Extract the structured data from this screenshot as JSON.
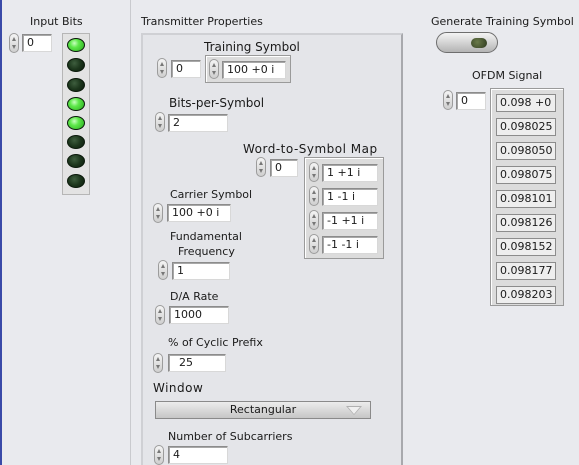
{
  "input_bits": {
    "title": "Input Bits",
    "index": "0",
    "leds": [
      true,
      false,
      false,
      true,
      true,
      false,
      false,
      false
    ]
  },
  "transmitter": {
    "title": "Transmitter Properties",
    "training_symbol": {
      "label": "Training Symbol",
      "index": "0",
      "value": "100 +0 i"
    },
    "bits_per_symbol": {
      "label": "Bits-per-Symbol",
      "value": "2"
    },
    "word_map": {
      "label": "Word-to-Symbol Map",
      "index": "0",
      "values": [
        "1 +1 i",
        "1 -1 i",
        "-1 +1 i",
        "-1 -1 i"
      ]
    },
    "carrier_symbol": {
      "label": "Carrier Symbol",
      "value": "100 +0 i"
    },
    "fundamental_frequency": {
      "label_line1": "Fundamental",
      "label_line2": "Frequency",
      "value": "1"
    },
    "da_rate": {
      "label": "D/A Rate",
      "value": "1000"
    },
    "cyclic_prefix": {
      "label": "% of Cyclic Prefix",
      "value": "25"
    },
    "window": {
      "label": "Window",
      "value": "Rectangular"
    },
    "subcarriers": {
      "label": "Number of Subcarriers",
      "value": "4"
    }
  },
  "generate": {
    "label": "Generate Training Symbol",
    "state": false
  },
  "ofdm": {
    "label": "OFDM Signal",
    "index": "0",
    "values": [
      "0.098 +0",
      "0.098025",
      "0.098050",
      "0.098075",
      "0.098101",
      "0.098126",
      "0.098152",
      "0.098177",
      "0.098203"
    ]
  }
}
